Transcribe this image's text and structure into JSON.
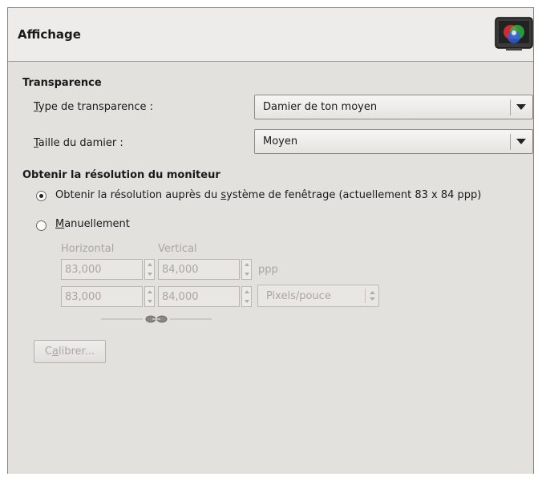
{
  "header": {
    "title": "Affichage",
    "icon": "monitor-color-icon"
  },
  "transparency": {
    "section_title": "Transparence",
    "type_label_pre": "",
    "type_label_ul": "T",
    "type_label_post": "ype de transparence :",
    "type_value": "Damier de ton moyen",
    "size_label_ul": "T",
    "size_label_post": "aille du damier :",
    "size_value": "Moyen"
  },
  "resolution": {
    "section_title": "Obtenir la résolution du moniteur",
    "radio_system_pre": "Obtenir la résolution auprès du ",
    "radio_system_ul": "s",
    "radio_system_post": "ystème de fenêtrage (actuellement 83 x 84 ppp)",
    "radio_system_checked": true,
    "radio_manual_ul": "M",
    "radio_manual_post": "anuellement",
    "radio_manual_checked": false,
    "col_horizontal": "Horizontal",
    "col_vertical": "Vertical",
    "row1_h": "83,000",
    "row1_v": "84,000",
    "row1_unit": "ppp",
    "row2_h": "83,000",
    "row2_v": "84,000",
    "row2_unit": "Pixels/pouce",
    "calibrate_pre": "C",
    "calibrate_ul": "a",
    "calibrate_post": "librer..."
  }
}
